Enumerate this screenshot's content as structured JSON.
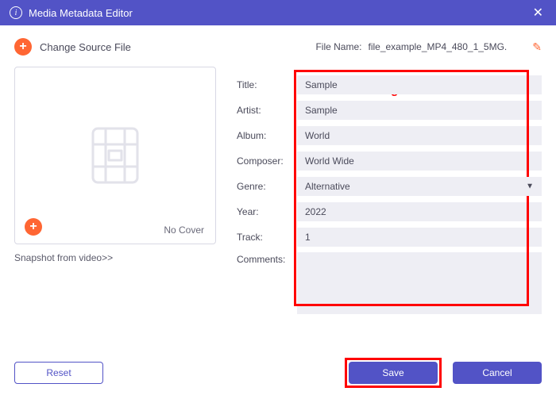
{
  "titlebar": {
    "title": "Media Metadata Editor"
  },
  "source": {
    "change_label": "Change Source File",
    "filename_label": "File Name:",
    "filename_value": "file_example_MP4_480_1_5MG."
  },
  "annotation": "add tags",
  "cover": {
    "no_cover": "No Cover",
    "snapshot": "Snapshot from video>>"
  },
  "fields": {
    "title": {
      "label": "Title:",
      "value": "Sample"
    },
    "artist": {
      "label": "Artist:",
      "value": "Sample"
    },
    "album": {
      "label": "Album:",
      "value": "World"
    },
    "composer": {
      "label": "Composer:",
      "value": "World Wide"
    },
    "genre": {
      "label": "Genre:",
      "value": "Alternative"
    },
    "year": {
      "label": "Year:",
      "value": "2022"
    },
    "track": {
      "label": "Track:",
      "value": "1"
    },
    "comments": {
      "label": "Comments:",
      "value": ""
    }
  },
  "footer": {
    "reset": "Reset",
    "save": "Save",
    "cancel": "Cancel"
  }
}
